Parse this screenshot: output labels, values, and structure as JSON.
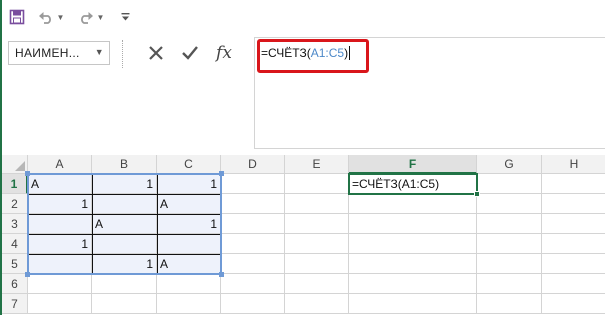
{
  "quick_access": {
    "save_icon": "save-icon",
    "undo_icon": "undo-icon",
    "redo_icon": "redo-icon",
    "customize_icon": "customize-toolbar-icon"
  },
  "formula_bar": {
    "name_box_value": "НАИМЕН...",
    "cancel_icon": "cancel-icon",
    "enter_icon": "enter-checkmark-icon",
    "fx_label": "fx",
    "formula_prefix": "=СЧЁТЗ(",
    "formula_ref": "A1:C5",
    "formula_suffix": ")",
    "highlight_color": "#d9161b"
  },
  "grid": {
    "columns": [
      "A",
      "B",
      "C",
      "D",
      "E",
      "F",
      "G",
      "H"
    ],
    "active_column": "F",
    "rows": [
      "1",
      "2",
      "3",
      "4",
      "5",
      "6",
      "7"
    ],
    "active_row": "1",
    "range_color": "#6f9ad6",
    "cells": {
      "A1": "A",
      "B1": "1",
      "C1": "1",
      "A2": "1",
      "C2": "A",
      "B3": "A",
      "C3": "1",
      "A4": "1",
      "B5": "1",
      "C5": "A",
      "F1": "=СЧЁТЗ(A1:C5)"
    }
  }
}
